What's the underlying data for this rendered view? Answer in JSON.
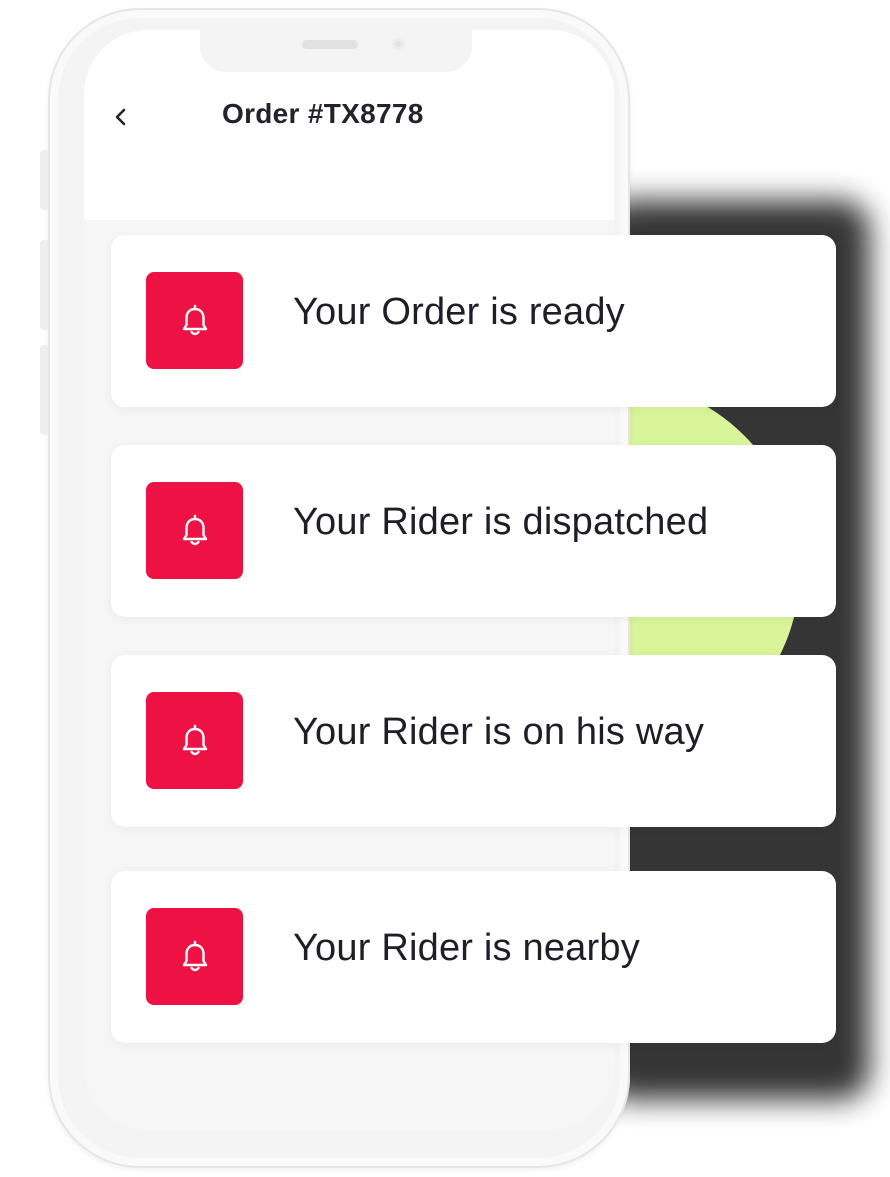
{
  "header": {
    "back_icon": "chevron-left-icon",
    "title": "Order #TX8778"
  },
  "notifications": [
    {
      "icon": "bell-icon",
      "text": "Your Order is ready"
    },
    {
      "icon": "bell-icon",
      "text": "Your Rider is dispatched"
    },
    {
      "icon": "bell-icon",
      "text": "Your Rider is on his way"
    },
    {
      "icon": "bell-icon",
      "text": "Your Rider is nearby"
    }
  ],
  "colors": {
    "accent": "#ee1143",
    "decor_circle": "#d9f59a",
    "title_text": "#23232e"
  }
}
